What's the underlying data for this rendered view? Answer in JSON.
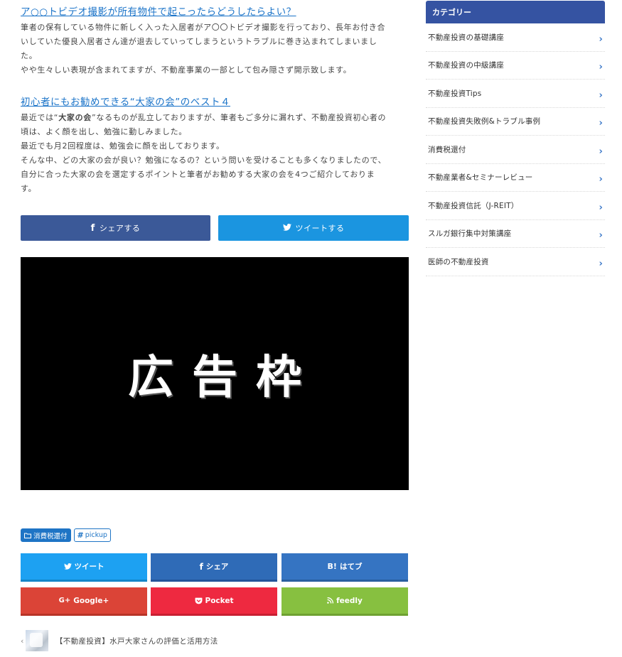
{
  "main": {
    "article1": {
      "title": "ア○○トビデオ撮影が所有物件で起こったらどうしたらよい？",
      "lines": [
        "筆者の保有している物件に新しく入った入居者がア〇〇トビデオ撮影を行っており、長年お付き合",
        "いしていた優良入居者さん達が退去していってしまうというトラブルに巻き込まれてしまいまし",
        "た。",
        "やや生々しい表現が含まれてますが、不動産事業の一部として包み隠さず開示致します。"
      ]
    },
    "article2": {
      "title": "初心者にもお勧めできる“大家の会”のベスト４",
      "line1_pre": "最近では“",
      "line1_bold": "大家の会",
      "line1_post": "”なるものが乱立しておりますが、筆者もご多分に漏れず、不動産投資初心者の",
      "lines": [
        "頃は、よく顔を出し、勉強に勤しみました。",
        "最近でも月2回程度は、勉強会に顔を出しております。",
        "そんな中、どの大家の会が良い？勉強になるの？という問いを受けることも多くなりましたので、",
        "自分に合った大家の会を選定するポイントと筆者がお勧めする大家の会を4つご紹介しておりま",
        "す。"
      ]
    },
    "share": {
      "facebook": "シェアする",
      "twitter": "ツイートする"
    },
    "ad_text": "広告枠",
    "tags": {
      "category": "消費税還付",
      "tag": "pickup"
    },
    "sns": {
      "tweet": "ツイート",
      "share": "シェア",
      "hatebu": "はてブ",
      "google": "Google+",
      "pocket": "Pocket",
      "feedly": "feedly"
    },
    "prev_post": {
      "arrow": "‹",
      "title": "【不動産投資】水戸大家さんの評価と活用方法"
    }
  },
  "sidebar": {
    "heading": "カテゴリー",
    "categories": [
      "不動産投資の基礎講座",
      "不動産投資の中級講座",
      "不動産投資Tips",
      "不動産投資失敗例&トラブル事例",
      "消費税還付",
      "不動産業者&セミナーレビュー",
      "不動産投資信託（J-REIT）",
      "スルガ銀行集中対策講座",
      "医師の不動産投資"
    ]
  },
  "colors": {
    "link": "#1a73c8",
    "sidebar_header": "#3553a2",
    "facebook": "#3b5998",
    "twitter": "#1b95e0",
    "google": "#db4437",
    "pocket": "#ee2940",
    "feedly": "#87c040"
  },
  "icons": [
    "facebook-icon",
    "twitter-icon",
    "folder-icon",
    "hash-icon",
    "hatena-icon",
    "google-plus-icon",
    "pocket-icon",
    "rss-icon",
    "chevron-right-icon"
  ]
}
